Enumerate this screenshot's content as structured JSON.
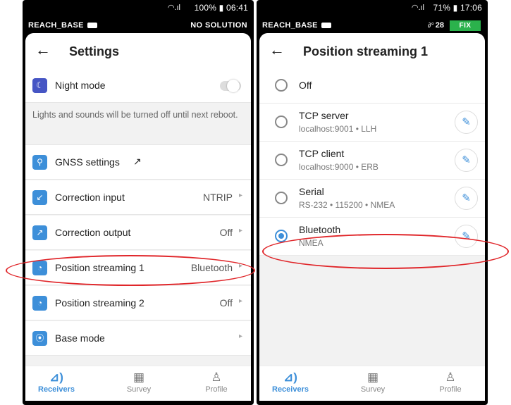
{
  "left": {
    "status": {
      "text": "100% ▮ 06:41"
    },
    "device": {
      "name": "REACH_BASE",
      "solution": "NO SOLUTION"
    },
    "header": {
      "title": "Settings"
    },
    "night_mode": {
      "label": "Night mode",
      "enabled": false
    },
    "info": "Lights and sounds will be turned off until next reboot.",
    "items": [
      {
        "label": "GNSS settings",
        "value": "",
        "icon": "satellite-icon",
        "external": true
      },
      {
        "label": "Correction input",
        "value": "NTRIP",
        "icon": "arrow-down-left-icon"
      },
      {
        "label": "Correction output",
        "value": "Off",
        "icon": "arrow-up-right-icon"
      },
      {
        "label": "Position streaming 1",
        "value": "Bluetooth",
        "icon": "stream-icon"
      },
      {
        "label": "Position streaming 2",
        "value": "Off",
        "icon": "stream-icon"
      },
      {
        "label": "Base mode",
        "value": "",
        "icon": "antenna-icon"
      }
    ]
  },
  "right": {
    "status": {
      "text": "71% ▮ 17:06"
    },
    "device": {
      "name": "REACH_BASE",
      "satellites": "28",
      "solution": "FIX"
    },
    "header": {
      "title": "Position streaming 1"
    },
    "options": [
      {
        "title": "Off",
        "subtitle": "",
        "selected": false,
        "editable": false
      },
      {
        "title": "TCP server",
        "subtitle": "localhost:9001 • LLH",
        "selected": false,
        "editable": true
      },
      {
        "title": "TCP client",
        "subtitle": "localhost:9000 • ERB",
        "selected": false,
        "editable": true
      },
      {
        "title": "Serial",
        "subtitle": "RS-232 • 115200 • NMEA",
        "selected": false,
        "editable": true
      },
      {
        "title": "Bluetooth",
        "subtitle": "NMEA",
        "selected": true,
        "editable": true
      }
    ]
  },
  "nav": [
    {
      "label": "Receivers",
      "icon": "receivers-icon",
      "active": true
    },
    {
      "label": "Survey",
      "icon": "survey-icon",
      "active": false
    },
    {
      "label": "Profile",
      "icon": "profile-icon",
      "active": false
    }
  ],
  "colors": {
    "accent": "#3d8fd9",
    "fix": "#2bb24c",
    "night_icon": "#4655c4",
    "highlight": "#e0262a"
  }
}
